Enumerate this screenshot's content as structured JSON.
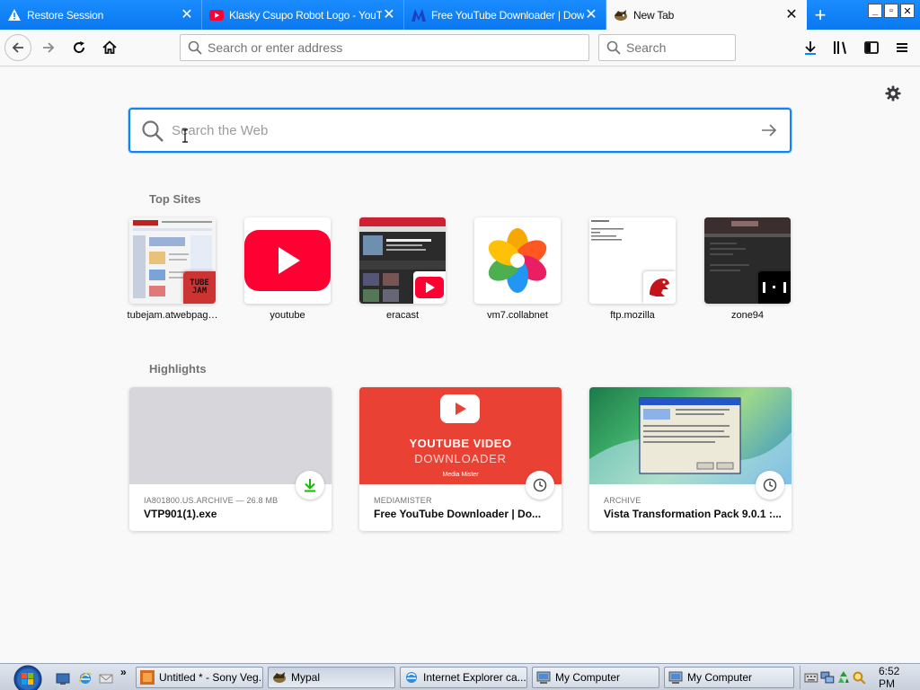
{
  "tabs": [
    {
      "title": "Restore Session",
      "icon": "warning-icon"
    },
    {
      "title": "Klasky Csupo Robot Logo - YouTube",
      "icon": "youtube-icon"
    },
    {
      "title": "Free YouTube Downloader | Downl",
      "icon": "mediamister-icon"
    },
    {
      "title": "New Tab",
      "icon": "mypal-icon"
    }
  ],
  "toolbar": {
    "url_placeholder": "Search or enter address",
    "search_placeholder": "Search"
  },
  "content": {
    "web_search_placeholder": "Search the Web",
    "top_sites_heading": "Top Sites",
    "highlights_heading": "Highlights"
  },
  "top_sites": [
    {
      "label": "tubejam.atwebpag…",
      "corner": "TUBE JAM"
    },
    {
      "label": "youtube"
    },
    {
      "label": "eracast"
    },
    {
      "label": "vm7.collabnet"
    },
    {
      "label": "ftp.mozilla"
    },
    {
      "label": "zone94"
    }
  ],
  "highlights": [
    {
      "source": "IA801800.US.ARCHIVE — 26.8 MB",
      "title": "VTP901(1).exe",
      "badge": "download-icon"
    },
    {
      "source": "MEDIAMISTER",
      "title": "Free YouTube Downloader | Do...",
      "badge": "clock-icon",
      "art_line1": "YOUTUBE VIDEO",
      "art_line2": "DOWNLOADER",
      "art_brand": "Media Mister"
    },
    {
      "source": "ARCHIVE",
      "title": "Vista Transformation Pack 9.0.1 :...",
      "badge": "clock-icon"
    }
  ],
  "taskbar": {
    "items": [
      {
        "label": "Untitled * - Sony Veg..."
      },
      {
        "label": "Mypal"
      },
      {
        "label": "Internet Explorer ca..."
      },
      {
        "label": "My Computer"
      },
      {
        "label": "My Computer"
      }
    ],
    "clock": "6:52 PM"
  },
  "colors": {
    "accent": "#0a84ff",
    "youtube_red": "#ff0033"
  }
}
